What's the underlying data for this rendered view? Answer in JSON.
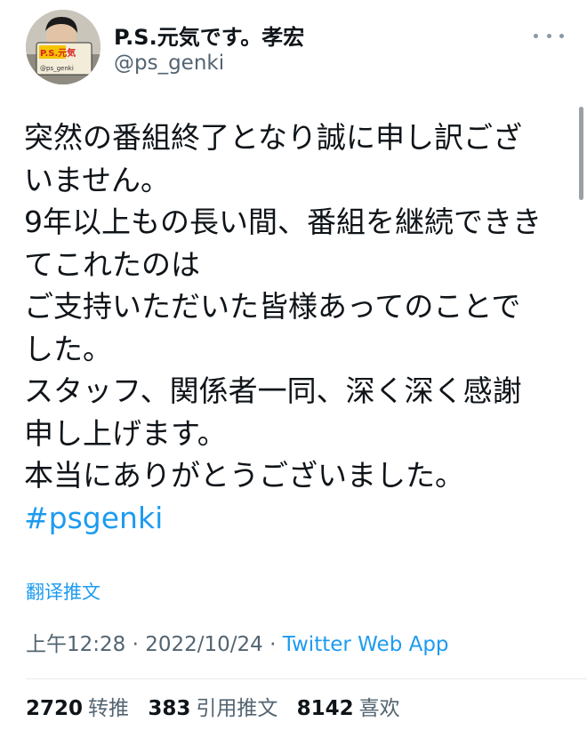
{
  "author": {
    "display_name": "P.S.元気です。孝宏",
    "handle": "@ps_genki",
    "avatar_sign_text": "P.S.元気",
    "avatar_sign_handle": "@ps_genki"
  },
  "tweet": {
    "lines": [
      "突然の番組終了となり誠に申し訳ござ",
      "いません。",
      "9年以上もの長い間、番組を継続できき",
      "てこれたのは",
      "ご支持いただいた皆様あってのことで",
      "した。",
      "スタッフ、関係者一同、深く深く感謝",
      "申し上げます。",
      "本当にありがとうございました。"
    ],
    "hashtag": "#psgenki",
    "translate_label": "翻译推文"
  },
  "meta": {
    "time": "上午12:28",
    "sep1": " · ",
    "date": "2022/10/24",
    "sep2": " · ",
    "source": "Twitter Web App"
  },
  "stats": {
    "retweets_count": "2720",
    "retweets_label": "转推",
    "quotes_count": "383",
    "quotes_label": "引用推文",
    "likes_count": "8142",
    "likes_label": "喜欢"
  },
  "icons": {
    "more": "more-horizontal-icon"
  }
}
